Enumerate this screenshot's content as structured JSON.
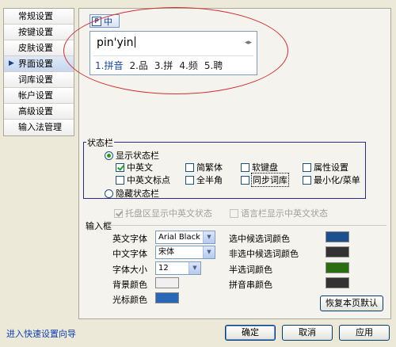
{
  "sidebar": {
    "items": [
      {
        "label": "常规设置",
        "active": false
      },
      {
        "label": "按键设置",
        "active": false
      },
      {
        "label": "皮肤设置",
        "active": false
      },
      {
        "label": "界面设置",
        "active": true
      },
      {
        "label": "词库设置",
        "active": false
      },
      {
        "label": "帐户设置",
        "active": false
      },
      {
        "label": "高级设置",
        "active": false
      },
      {
        "label": "输入法管理",
        "active": false
      }
    ]
  },
  "preview": {
    "mode_label": "中",
    "logo_glyph": "P",
    "pinyin": "pin'yin",
    "page_arrows": "◂▸",
    "candidates": [
      "1.拼音",
      "2.品",
      "3.拼",
      "4.频",
      "5.聘"
    ]
  },
  "status_bar": {
    "title": "状态栏",
    "show_label": "显示状态栏",
    "hide_label": "隐藏状态栏",
    "checkboxes": [
      {
        "label": "中英文",
        "checked": true
      },
      {
        "label": "简繁体",
        "checked": false
      },
      {
        "label": "软键盘",
        "checked": false
      },
      {
        "label": "属性设置",
        "checked": false
      },
      {
        "label": "中英文标点",
        "checked": false
      },
      {
        "label": "全半角",
        "checked": false
      },
      {
        "label": "同步词库",
        "checked": false
      },
      {
        "label": "最小化/菜单",
        "checked": false
      }
    ],
    "tray_label": "托盘区显示中英文状态",
    "lang_bar_label": "语言栏显示中英文状态"
  },
  "input_box": {
    "title": "输入框",
    "en_font_label": "英文字体",
    "en_font_value": "Arial Black",
    "cn_font_label": "中文字体",
    "cn_font_value": "宋体",
    "size_label": "字体大小",
    "size_value": "12",
    "bg_color_label": "背景颜色",
    "cursor_color_label": "光标颜色",
    "sel_cand_label": "选中候选词颜色",
    "unsel_cand_label": "非选中候选词颜色",
    "half_sel_label": "半选词颜色",
    "pinyin_color_label": "拼音串颜色",
    "restore_label": "恢复本页默认"
  },
  "colors": {
    "bg": "#f0f0f0",
    "cursor": "#2a66b8",
    "sel_cand": "#1c4f8e",
    "unsel_cand": "#333333",
    "half_sel": "#2b6e12",
    "pinyin": "#333333"
  },
  "footer": {
    "wizard_link": "进入快速设置向导",
    "ok_label": "确定",
    "cancel_label": "取消",
    "apply_label": "应用"
  }
}
